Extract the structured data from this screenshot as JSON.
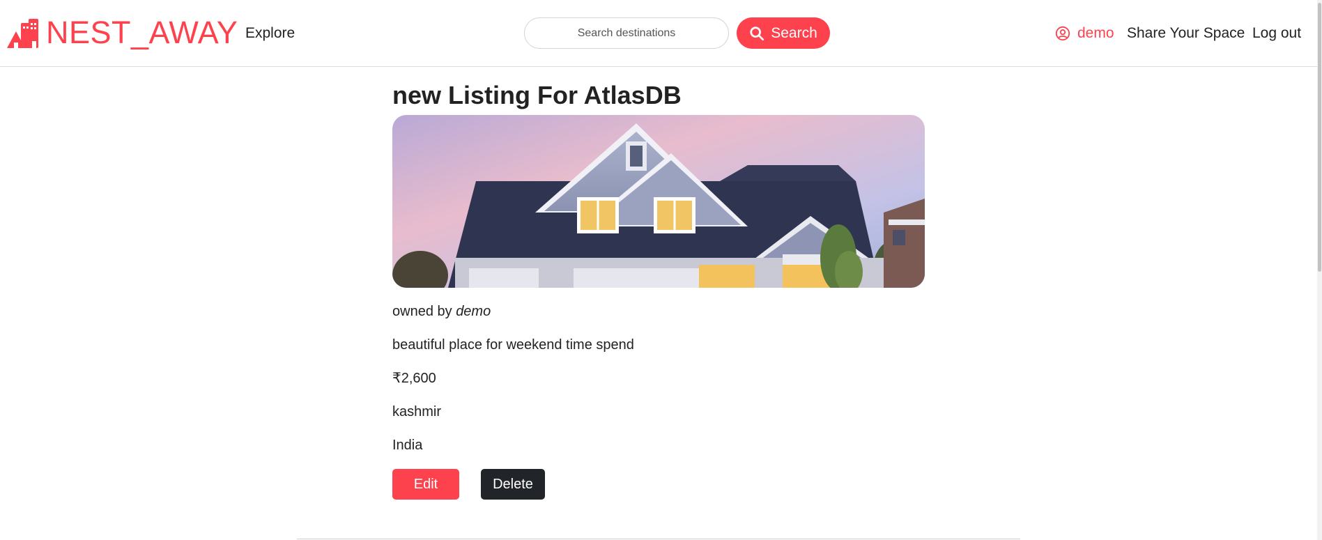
{
  "navbar": {
    "brand_text": "NEST_AWAY",
    "brand_icon": "city-buildings-icon",
    "explore_label": "Explore",
    "search_placeholder": "Search destinations",
    "search_button_label": "Search",
    "user_name": "demo",
    "share_label": "Share Your Space",
    "logout_label": "Log out"
  },
  "listing": {
    "title": "new Listing For AtlasDB",
    "owner_prefix": "owned by",
    "owner_name": "demo",
    "description": "beautiful place for weekend time spend",
    "price": "₹2,600",
    "location": "kashmir",
    "country": "India",
    "image_subject": "house-photo"
  },
  "actions": {
    "edit_label": "Edit",
    "delete_label": "Delete"
  },
  "colors": {
    "accent": "#fe424d",
    "dark_button": "#212529",
    "text": "#222222"
  }
}
